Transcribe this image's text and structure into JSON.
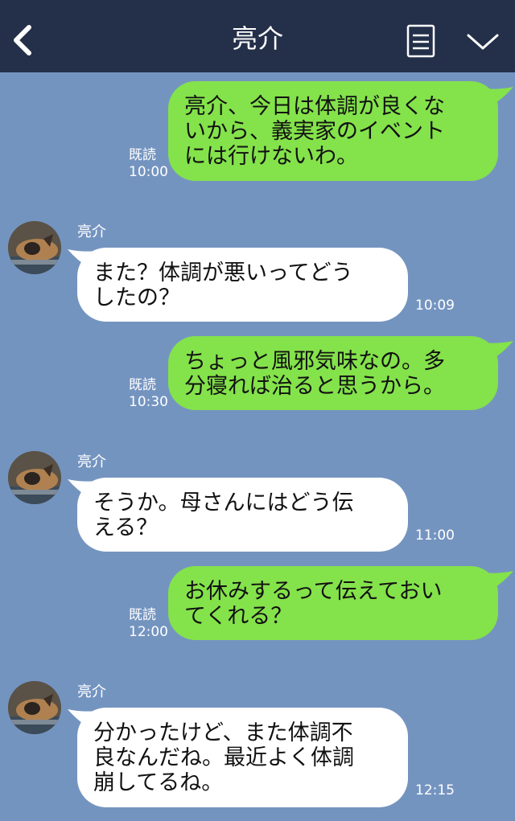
{
  "header": {
    "title": "亮介"
  },
  "messages": [
    {
      "type": "sent",
      "text": "亮介、今日は体調が良くな\nいから、義実家のイベント\nには行けないわ。",
      "read": "既読",
      "time": "10:00"
    },
    {
      "type": "received",
      "sender": "亮介",
      "text": "また？体調が悪いってどう\nしたの？",
      "time": "10:09"
    },
    {
      "type": "sent",
      "text": "ちょっと風邪気味なの。多\n分寝れば治ると思うから。",
      "read": "既読",
      "time": "10:30"
    },
    {
      "type": "received",
      "sender": "亮介",
      "text": "そうか。母さんにはどう伝\nえる？",
      "time": "11:00"
    },
    {
      "type": "sent",
      "text": "お休みするって伝えておい\nてくれる？",
      "read": "既読",
      "time": "12:00"
    },
    {
      "type": "received",
      "sender": "亮介",
      "text": "分かったけど、また体調不\n良なんだね。最近よく体調\n崩してるね。",
      "time": "12:15"
    }
  ],
  "icons": {
    "back": "chevron-left-icon",
    "notes": "note-icon",
    "menu": "chevron-down-icon"
  },
  "colors": {
    "background": "#7494c0",
    "header": "#243049",
    "sent_bubble": "#84e24b",
    "received_bubble": "#ffffff"
  }
}
